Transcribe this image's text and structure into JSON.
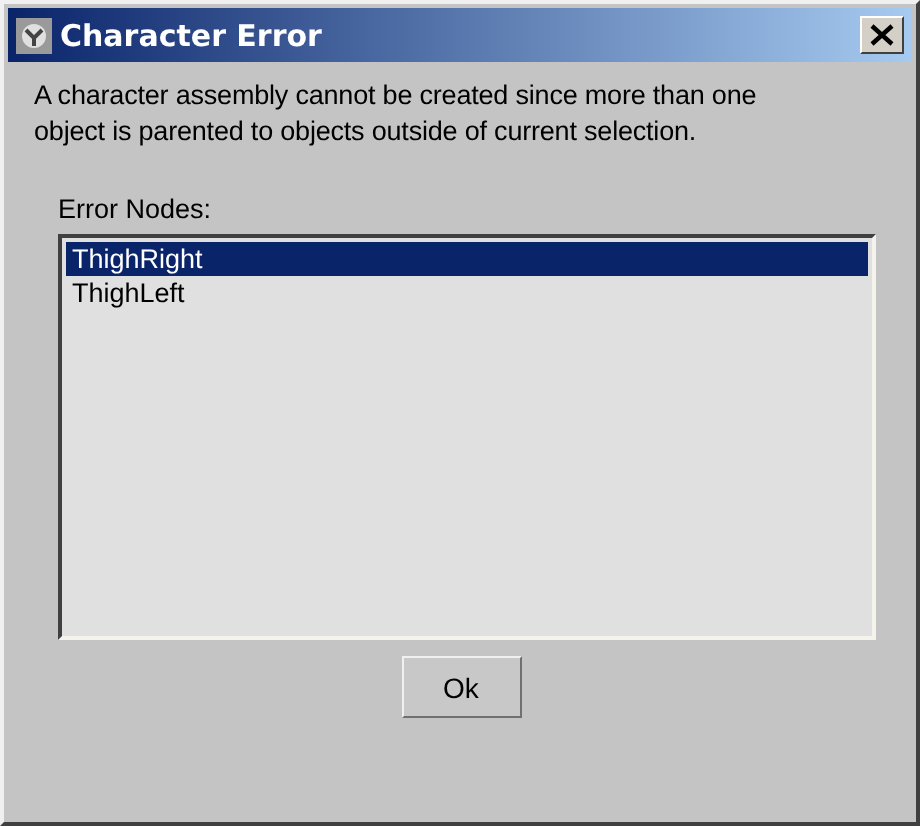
{
  "window": {
    "title": "Character Error"
  },
  "message": "A character assembly cannot be created since more than one object is parented to objects outside of current selection.",
  "list": {
    "label": "Error Nodes:",
    "items": [
      {
        "label": "ThighRight",
        "selected": true
      },
      {
        "label": "ThighLeft",
        "selected": false
      }
    ]
  },
  "buttons": [
    "Ok"
  ]
}
